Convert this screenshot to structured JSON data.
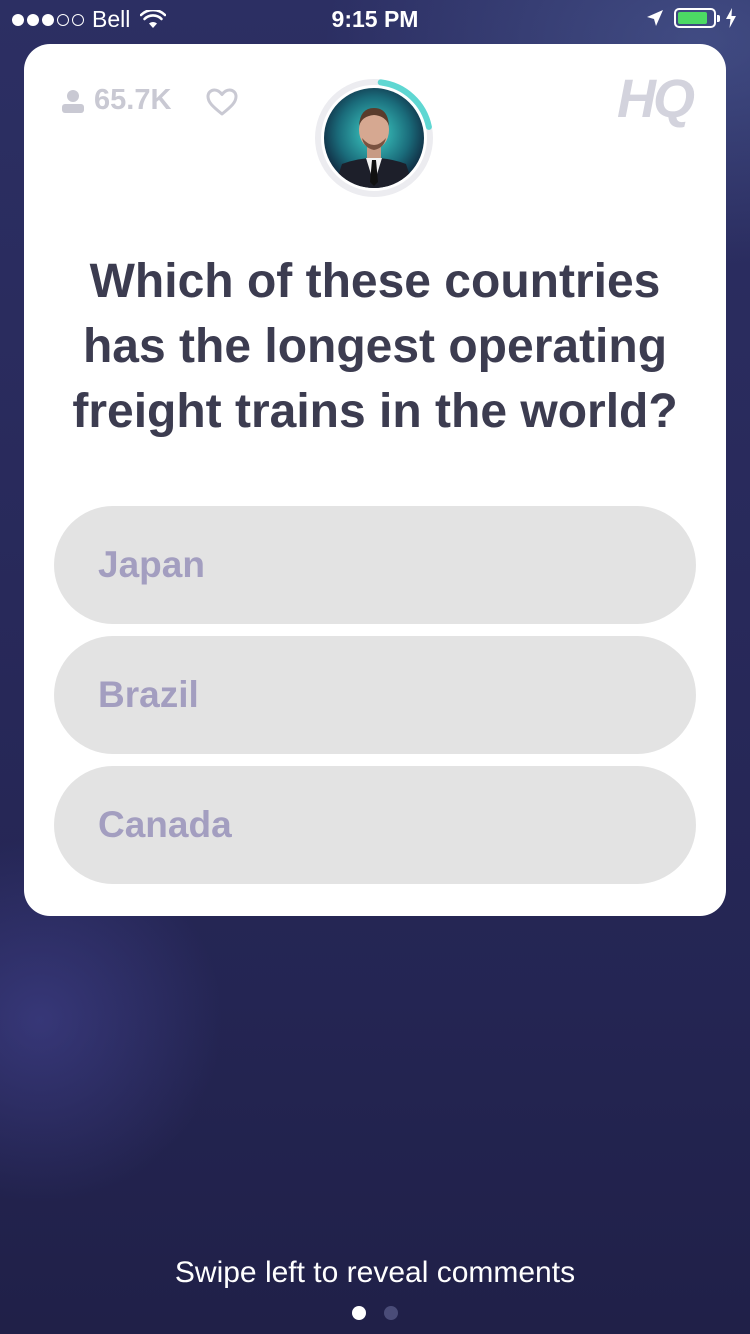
{
  "status_bar": {
    "carrier": "Bell",
    "time": "9:15 PM",
    "signal_bars_filled": 3,
    "signal_bars_total": 5,
    "battery_level": 0.85,
    "battery_color": "#4cd964"
  },
  "card": {
    "viewer_count": "65.7K",
    "logo": "HQ",
    "question": "Which of these countries has the longest operating freight trains in the world?",
    "answers": [
      {
        "label": "Japan"
      },
      {
        "label": "Brazil"
      },
      {
        "label": "Canada"
      }
    ],
    "timer_color": "#5fd7d2",
    "answer_bg_color": "#e3e3e3",
    "answer_text_color": "#a39ec0"
  },
  "footer": {
    "swipe_hint": "Swipe left to reveal comments",
    "pages": 2,
    "active_page": 1
  }
}
